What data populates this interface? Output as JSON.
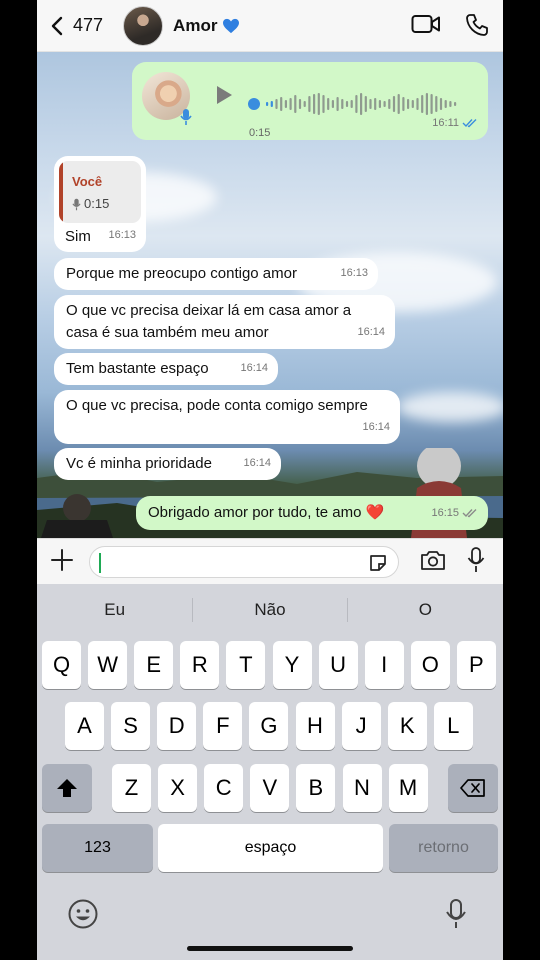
{
  "header": {
    "back_count": "477",
    "contact_name": "Amor"
  },
  "voice_message": {
    "duration": "0:15",
    "time": "16:11"
  },
  "messages": [
    {
      "quote_name": "Você",
      "quote_duration": "0:15",
      "text": "Sim",
      "time": "16:13",
      "direction": "in"
    },
    {
      "text": "Porque me preocupo contigo amor",
      "time": "16:13",
      "direction": "in"
    },
    {
      "text": "O que vc precisa deixar lá em casa amor a casa é sua também meu amor",
      "time": "16:14",
      "direction": "in"
    },
    {
      "text": "Tem bastante espaço",
      "time": "16:14",
      "direction": "in"
    },
    {
      "text": "O que vc precisa, pode conta comigo sempre",
      "time": "16:14",
      "direction": "in"
    },
    {
      "text": "Vc é minha prioridade",
      "time": "16:14",
      "direction": "in"
    },
    {
      "text": "Obrigado amor por tudo, te amo ❤️",
      "time": "16:15",
      "direction": "out"
    }
  ],
  "input": {
    "value": ""
  },
  "keyboard": {
    "suggestions": [
      "Eu",
      "Não",
      "O"
    ],
    "row1": [
      "Q",
      "W",
      "E",
      "R",
      "T",
      "Y",
      "U",
      "I",
      "O",
      "P"
    ],
    "row2": [
      "A",
      "S",
      "D",
      "F",
      "G",
      "H",
      "J",
      "K",
      "L"
    ],
    "row3": [
      "Z",
      "X",
      "C",
      "V",
      "B",
      "N",
      "M"
    ],
    "numbers": "123",
    "space": "espaço",
    "return": "retorno"
  },
  "colors": {
    "outgoing_bubble": "#d2f8c8",
    "incoming_bubble": "#ffffff",
    "read_ticks": "#3a8dde",
    "quote_accent": "#b1432a"
  },
  "icons": [
    "chevron-left-icon",
    "video-call-icon",
    "phone-icon",
    "play-icon",
    "mic-icon",
    "plus-icon",
    "sticker-icon",
    "camera-icon",
    "shift-icon",
    "backspace-icon",
    "emoji-icon",
    "dictation-icon"
  ]
}
